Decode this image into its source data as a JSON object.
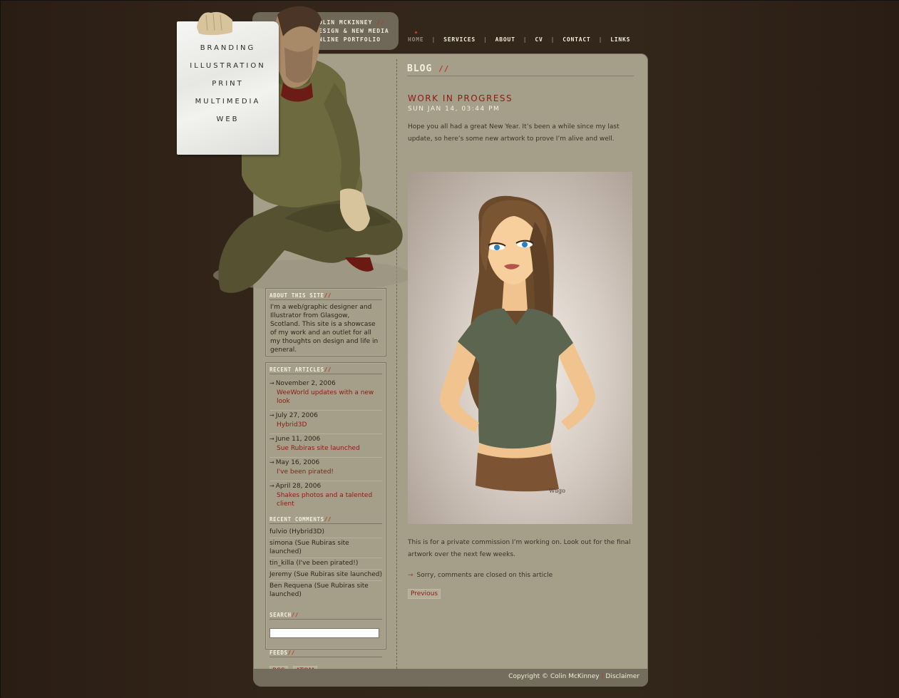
{
  "identity": {
    "name": "COLIN MCKINNEY",
    "slash": "//",
    "line2": "DESIGN & NEW MEDIA",
    "line3": "ONLINE PORTFOLIO"
  },
  "topnav": {
    "items": [
      {
        "label": "HOME",
        "active": true
      },
      {
        "label": "SERVICES"
      },
      {
        "label": "ABOUT"
      },
      {
        "label": "CV"
      },
      {
        "label": "CONTACT"
      },
      {
        "label": "LINKS"
      }
    ],
    "separator": "|"
  },
  "paper_menu": [
    "BRANDING",
    "ILLUSTRATION",
    "PRINT",
    "MULTIMEDIA",
    "WEB"
  ],
  "about": {
    "heading": "ABOUT THIS SITE",
    "text": "I'm a web/graphic designer and Illustrator from Glasgow, Scotland. This site is a showcase of my work and an outlet for all my thoughts on design and life in general."
  },
  "recent_articles": {
    "heading": "RECENT ARTICLES",
    "items": [
      {
        "date": "November 2, 2006",
        "title": "WeeWorld updates with a new look"
      },
      {
        "date": "July 27, 2006",
        "title": "Hybrid3D"
      },
      {
        "date": "June 11, 2006",
        "title": "Sue Rubiras site launched"
      },
      {
        "date": "May 16, 2006",
        "title": "I've been pirated!"
      },
      {
        "date": "April 28, 2006",
        "title": "Shakes photos and a talented client"
      }
    ]
  },
  "recent_comments": {
    "heading": "RECENT COMMENTS",
    "items": [
      "fulvio (Hybrid3D)",
      "simona (Sue Rubiras site launched)",
      "tin_killa (I've been pirated!)",
      "Jeremy (Sue Rubiras site launched)",
      "Ben Requena (Sue Rubiras site launched)"
    ]
  },
  "search": {
    "heading": "SEARCH",
    "value": "",
    "placeholder": ""
  },
  "feeds": {
    "heading": "FEEDS",
    "rss": "RSS",
    "atom": "ATOM"
  },
  "blog": {
    "heading": "BLOG",
    "post_title": "WORK IN PROGRESS",
    "post_date": "SUN JAN 14, 03:44 PM",
    "body1": "Hope you all had a great New Year. It’s been a while since my last update, so here’s some new artwork to prove I’m alive and well.",
    "body2": "This is for a private commission I’m working on. Look out for the final artwork over the next few weeks.",
    "comments_closed": "Sorry, comments are closed on this article",
    "previous": "Previous",
    "signature": "Wugo"
  },
  "footer": {
    "copyright": "Copyright © Colin McKinney",
    "separator": "|",
    "disclaimer": "Disclaimer"
  },
  "colors": {
    "background": "#2b2017",
    "panel": "#a59f89",
    "accent_red": "#8c1b14",
    "slash_red": "#b03a2a",
    "footer_bar": "#746d5e"
  }
}
